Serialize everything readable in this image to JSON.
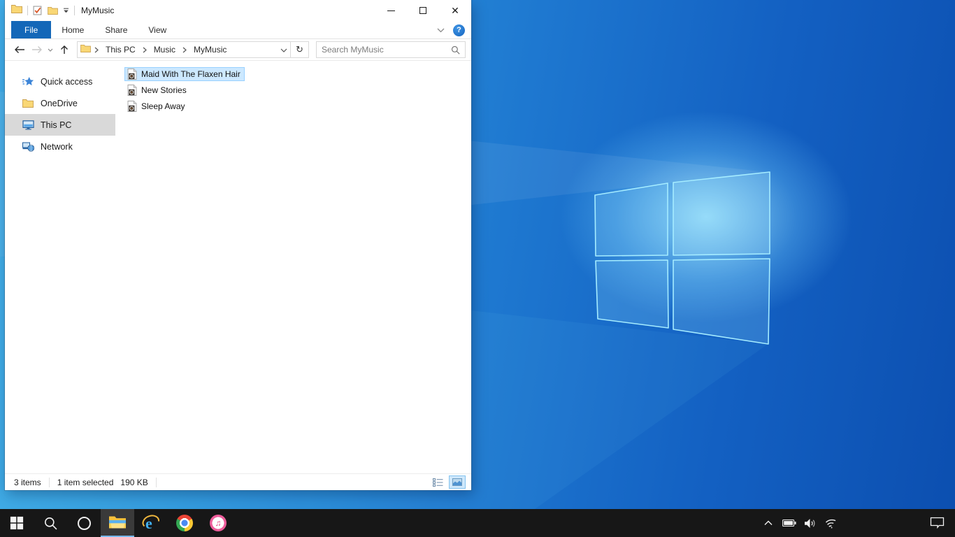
{
  "window": {
    "title": "MyMusic",
    "ribbon": {
      "tabs": [
        {
          "label": "File"
        },
        {
          "label": "Home"
        },
        {
          "label": "Share"
        },
        {
          "label": "View"
        }
      ],
      "active_tab": "File",
      "help_label": "?"
    },
    "nav": {
      "breadcrumb": [
        {
          "label": "This PC"
        },
        {
          "label": "Music"
        },
        {
          "label": "MyMusic"
        }
      ],
      "search_placeholder": "Search MyMusic"
    },
    "sidebar": {
      "items": [
        {
          "label": "Quick access",
          "icon": "quick-access-star-icon",
          "selected": false
        },
        {
          "label": "OneDrive",
          "icon": "onedrive-folder-icon",
          "selected": false
        },
        {
          "label": "This PC",
          "icon": "this-pc-monitor-icon",
          "selected": true
        },
        {
          "label": "Network",
          "icon": "network-icon",
          "selected": false
        }
      ]
    },
    "files": {
      "items": [
        {
          "name": "Maid With The Flaxen Hair",
          "icon": "audio-file-icon",
          "selected": true
        },
        {
          "name": "New Stories",
          "icon": "audio-file-icon",
          "selected": false
        },
        {
          "name": "Sleep Away",
          "icon": "audio-file-icon",
          "selected": false
        }
      ]
    },
    "status": {
      "count": "3 items",
      "selection": "1 item selected",
      "size": "190 KB"
    }
  },
  "taskbar": {
    "buttons": [
      {
        "icon": "start-icon",
        "active": false
      },
      {
        "icon": "search-icon",
        "active": false
      },
      {
        "icon": "cortana-icon",
        "active": false
      },
      {
        "icon": "file-explorer-icon",
        "active": true
      },
      {
        "icon": "internet-explorer-icon",
        "active": false
      },
      {
        "icon": "chrome-icon",
        "active": false
      },
      {
        "icon": "itunes-icon",
        "active": false
      }
    ],
    "tray": [
      {
        "icon": "tray-chevron-up-icon"
      },
      {
        "icon": "battery-icon"
      },
      {
        "icon": "volume-icon"
      },
      {
        "icon": "wifi-icon"
      }
    ],
    "action_center_icon": "action-center-icon"
  },
  "colors": {
    "accent_blue": "#1467b8",
    "selection_bg": "#cce8ff",
    "selection_border": "#99d1ff",
    "sidebar_selected_bg": "#d9d9d9",
    "taskbar_bg": "#171717",
    "taskbar_active_underline": "#76b9ed",
    "wallpaper_light": "#36a5e5",
    "wallpaper_dark": "#0c4fb0",
    "logo_stroke": "#a5ecff"
  }
}
